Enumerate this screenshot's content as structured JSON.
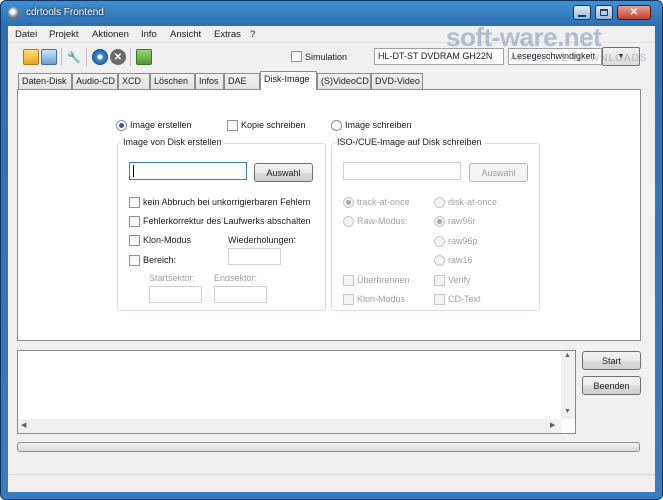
{
  "window": {
    "title": "cdrtools Frontend"
  },
  "menu": [
    "Datei",
    "Projekt",
    "Aktionen",
    "Info",
    "Ansicht",
    "Extras",
    "?"
  ],
  "toolbar": {
    "simulation_label": "Simulation",
    "drive_value": "HL-DT-ST DVDRAM GH22N",
    "speed_value": "Lesegeschwindigkeit"
  },
  "watermark": {
    "text": "soft-ware.net",
    "sub": "AKTUELLE DOWNLOADS"
  },
  "tabs": [
    "Daten-Disk",
    "Audio-CD",
    "XCD",
    "Löschen",
    "Infos",
    "DAE",
    "Disk-Image",
    "(S)VideoCD",
    "DVD-Video"
  ],
  "active_tab": "Disk-Image",
  "mode": {
    "image_erstellen": "Image erstellen",
    "kopie_schreiben": "Kopie schreiben",
    "image_schreiben": "Image schreiben"
  },
  "left_group": {
    "title": "Image von Disk erstellen",
    "browse_label": "Auswahl",
    "opt_no_abort": "kein Abbruch bei unkorrigierbaren Fehlern",
    "opt_disable_ecc": "Fehlerkorrektur des Laufwerks abschalten",
    "opt_clone": "Klon-Modus",
    "retries_label": "Wiederholungen:",
    "opt_range": "Bereich:",
    "start_sector_label": "Startsektor:",
    "end_sector_label": "Endsektor:"
  },
  "right_group": {
    "title": "ISO-/CUE-Image auf Disk schreiben",
    "browse_label": "Auswahl",
    "track_at_once": "track-at-once",
    "disk_at_once": "disk-at-once",
    "raw_mode": "Raw-Modus:",
    "raw96r": "raw96r",
    "raw96p": "raw96p",
    "raw16": "raw16",
    "overburn": "Überbrennen",
    "verify": "Verify",
    "clone_mode": "Klon-Modus",
    "cd_text": "CD-Text"
  },
  "actions": {
    "start": "Start",
    "stop": "Beenden"
  },
  "colors": {
    "title_bar": "#2f6fb3",
    "accent": "#2c5f9e"
  }
}
